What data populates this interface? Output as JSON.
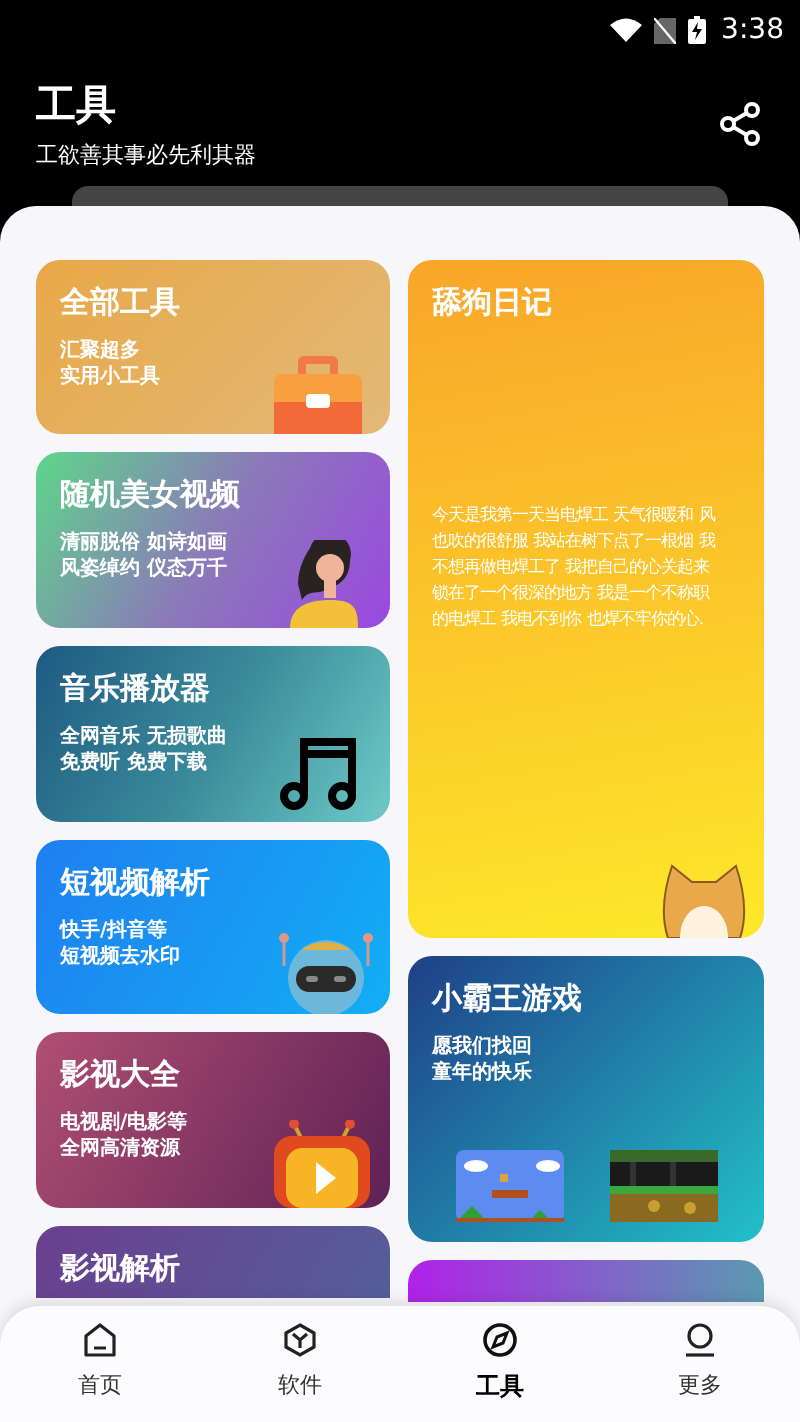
{
  "status_bar": {
    "time": "3:38"
  },
  "header": {
    "title": "工具",
    "subtitle": "工欲善其事必先利其器"
  },
  "left_cards": [
    {
      "kind": "briefcase",
      "title": "全部工具",
      "lines": [
        "汇聚超多",
        "实用小工具"
      ]
    },
    {
      "kind": "figure",
      "title": "随机美女视频",
      "lines": [
        "清丽脱俗 如诗如画",
        "风姿绰约 仪态万千"
      ]
    },
    {
      "kind": "music",
      "title": "音乐播放器",
      "lines": [
        "全网音乐 无损歌曲",
        "免费听 免费下载"
      ]
    },
    {
      "kind": "robot",
      "title": "短视频解析",
      "lines": [
        "快手/抖音等",
        "短视频去水印"
      ]
    },
    {
      "kind": "tv",
      "title": "影视大全",
      "lines": [
        "电视剧/电影等",
        "全网高清资源"
      ]
    },
    {
      "kind": "plain",
      "title": "影视解析"
    }
  ],
  "right_cards": [
    {
      "kind": "dog",
      "title": "舔狗日记",
      "text_lines": [
        "今天是我第一天当电焊工 天气很暖和 风",
        "也吹的很舒服 我站在树下点了一根烟 我",
        "不想再做电焊工了 我把自己的心关起来",
        "锁在了一个很深的地方 我是一个不称职",
        "的电焊工 我电不到你 也焊不牢你的心."
      ]
    },
    {
      "kind": "games",
      "title": "小霸王游戏",
      "lines": [
        "愿我们找回",
        "童年的快乐"
      ]
    },
    {
      "kind": "cut"
    }
  ],
  "tabs": [
    {
      "kind": "home",
      "label": "首页",
      "selected": false
    },
    {
      "kind": "cube",
      "label": "软件",
      "selected": false
    },
    {
      "kind": "compass",
      "label": "工具",
      "selected": true
    },
    {
      "kind": "person",
      "label": "更多",
      "selected": false
    }
  ]
}
